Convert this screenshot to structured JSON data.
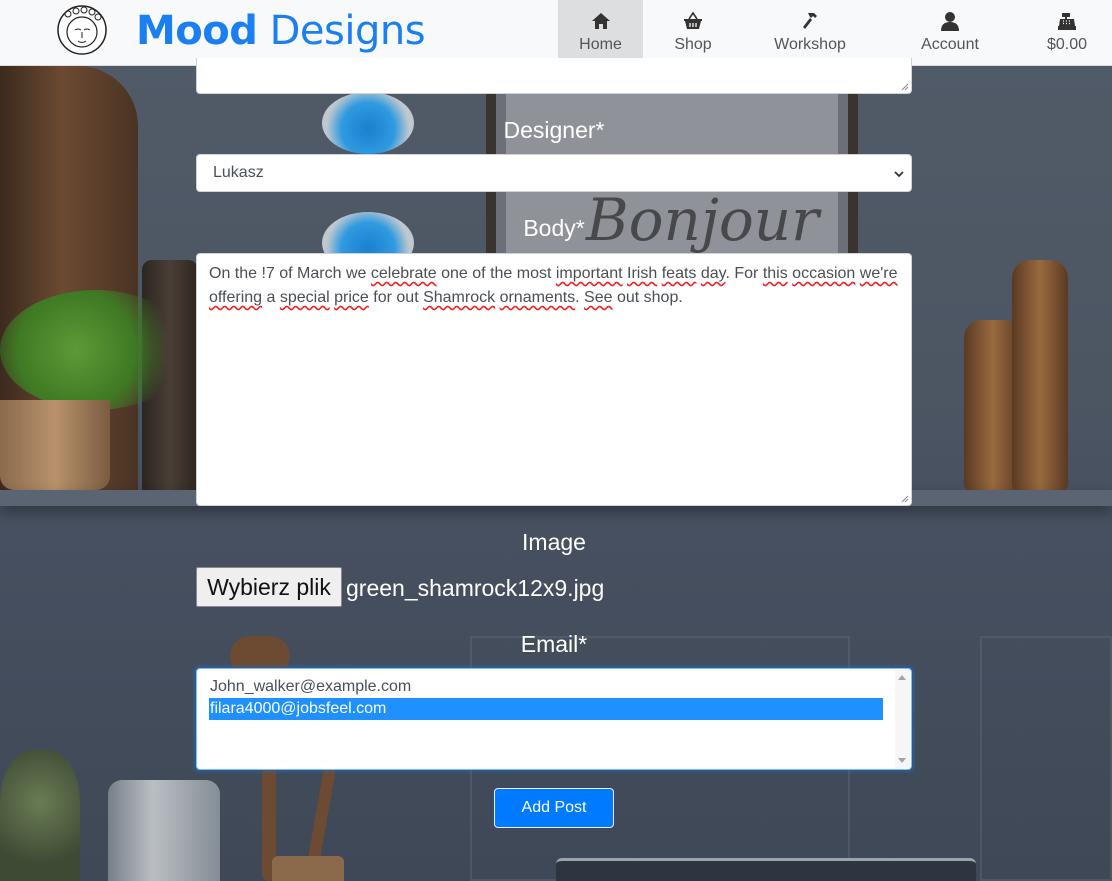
{
  "brand": {
    "part1": "Mood",
    "part2": "Designs"
  },
  "nav": {
    "home": "Home",
    "shop": "Shop",
    "workshop": "Workshop",
    "account": "Account",
    "cart_total": "$0.00"
  },
  "form": {
    "designer_label": "Designer*",
    "designer_value": "Lukasz",
    "body_label": "Body*",
    "body_text": {
      "w1": "On the !7 of March we ",
      "w2": "celebrate",
      "w3": " one of the most ",
      "w4": "important",
      "w5": " ",
      "w6": "Irish",
      "w7": " ",
      "w8": "feats",
      "w9": " ",
      "w10": "day",
      "w11": ". For ",
      "w12": "this",
      "w13": " ",
      "w14": "occasion",
      "w15": " ",
      "w16": "we're",
      "w17": " ",
      "w18": "offering",
      "w19": " a ",
      "w20": "special",
      "w21": " ",
      "w22": "price",
      "w23": " for out ",
      "w24": "Shamrock",
      "w25": " ",
      "w26": "ornaments",
      "w27": ". ",
      "w28": "See",
      "w29": " out shop."
    },
    "image_label": "Image",
    "file_button": "Wybierz plik",
    "file_name": "green_shamrock12x9.jpg",
    "email_label": "Email*",
    "email_options": [
      "John_walker@example.com",
      "filara4000@jobsfeel.com"
    ],
    "email_selected_index": 1,
    "submit_label": "Add Post"
  },
  "colors": {
    "brand": "#1a7ff0",
    "primary_button": "#007bff",
    "selection": "#1e90ff",
    "nav_bg": "#f8f9fa",
    "nav_active": "#dcdedf"
  },
  "icons": {
    "home": "home-icon",
    "shop": "basket-icon",
    "workshop": "hammer-icon",
    "account": "user-icon",
    "cart": "cash-register-icon"
  }
}
